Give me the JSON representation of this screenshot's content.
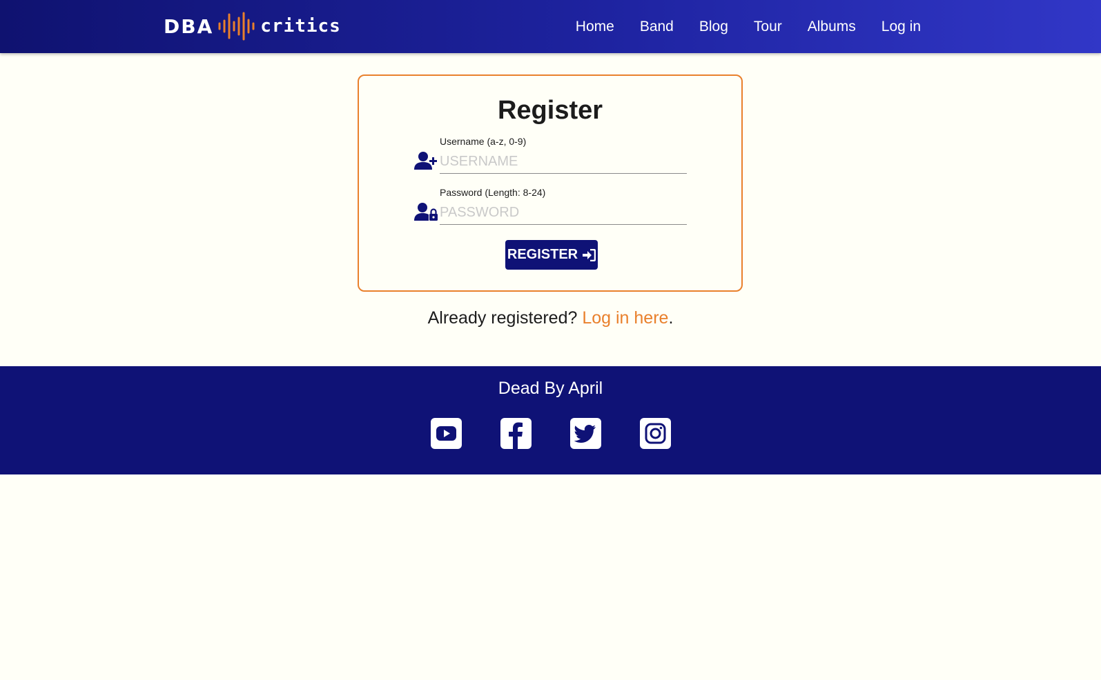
{
  "nav": {
    "logo": {
      "left": "DBA",
      "right": "critics"
    },
    "links": [
      {
        "label": "Home"
      },
      {
        "label": "Band"
      },
      {
        "label": "Blog"
      },
      {
        "label": "Tour"
      },
      {
        "label": "Albums"
      },
      {
        "label": "Log in"
      }
    ]
  },
  "register": {
    "title": "Register",
    "username": {
      "label": "Username (a-z, 0-9)",
      "placeholder": "USERNAME",
      "value": ""
    },
    "password": {
      "label": "Password (Length: 8-24)",
      "placeholder": "PASSWORD",
      "value": ""
    },
    "submit_label": "REGISTER",
    "already_text": "Already registered?",
    "login_link": "Log in here",
    "period": "."
  },
  "footer": {
    "title": "Dead By April",
    "social": [
      "youtube-icon",
      "facebook-icon",
      "twitter-icon",
      "instagram-icon"
    ]
  },
  "colors": {
    "nav_gradient_start": "#0f1270",
    "nav_gradient_end": "#3137c7",
    "accent_orange": "#e9802c",
    "primary_navy": "#0f1276",
    "background": "#fffff7"
  }
}
